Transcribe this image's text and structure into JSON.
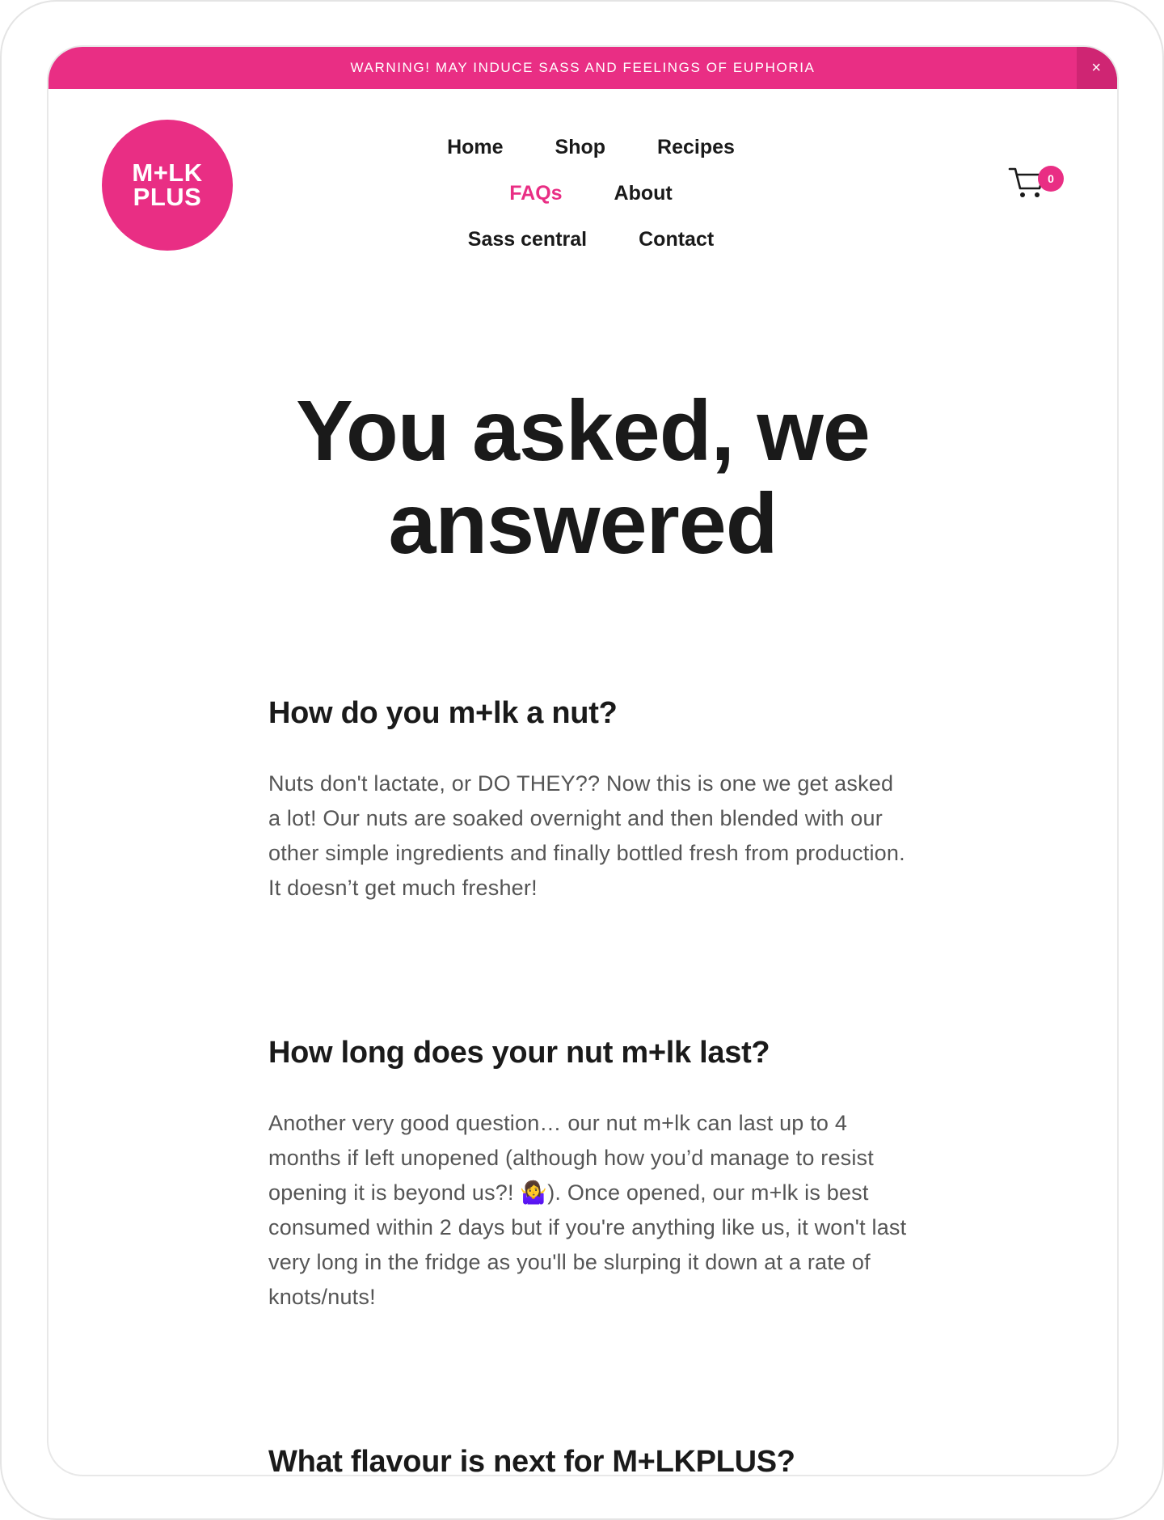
{
  "announcement": {
    "text": "WARNING! MAY INDUCE SASS AND FEELINGS OF EUPHORIA",
    "close_label": "×"
  },
  "logo": {
    "line1": "M+LK",
    "line2": "PLUS"
  },
  "nav": {
    "row1": [
      "Home",
      "Shop",
      "Recipes"
    ],
    "row2": [
      "FAQs",
      "About"
    ],
    "row3": [
      "Sass central",
      "Contact"
    ],
    "active": "FAQs"
  },
  "cart": {
    "icon": "cart-icon",
    "count": "0"
  },
  "hero": {
    "line1": "You asked, we",
    "line2": "answered"
  },
  "faqs": [
    {
      "question": "How do you m+lk a nut?",
      "answer": "Nuts don't lactate, or DO THEY?? Now this is one we get asked a lot! Our nuts are soaked overnight and then blended with our other simple ingredients and finally bottled fresh from production. It doesn’t get much fresher!"
    },
    {
      "question": "How long does your nut m+lk last?",
      "answer": "Another very good question… our nut m+lk can last up to 4 months if left unopened (although how you’d manage to resist opening it is beyond us?! 🤷‍♀️). Once opened, our m+lk is best consumed within 2 days but if you're anything like us, it won't last very long in the fridge as you'll be slurping it down at a rate of knots/nuts!"
    },
    {
      "question": "What flavour is next for M+LKPLUS?"
    }
  ],
  "colors": {
    "accent": "#e92e84",
    "accent_dark": "#cf2573",
    "text": "#1a1a1a",
    "body_text": "#555555"
  }
}
